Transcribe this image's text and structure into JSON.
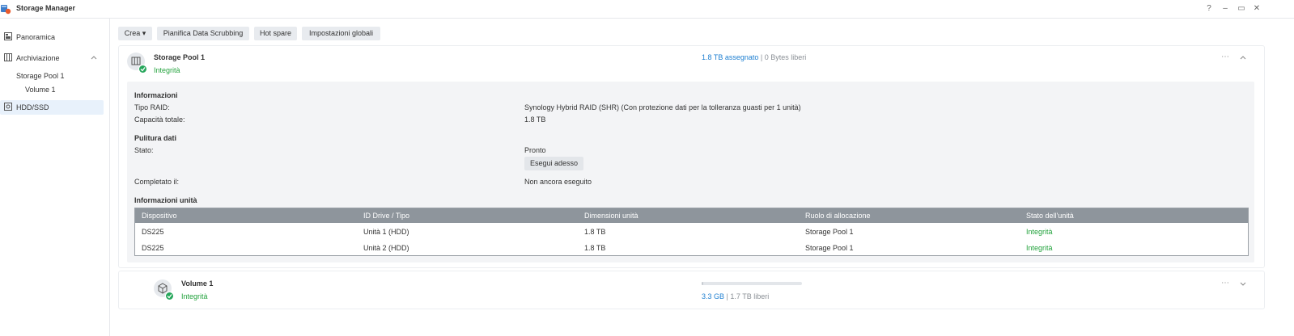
{
  "window": {
    "title": "Storage Manager",
    "help": "?",
    "minimize": "–",
    "restore": "▭",
    "close": "✕"
  },
  "sidebar": {
    "items": [
      {
        "label": "Panoramica",
        "icon": "overview-icon"
      },
      {
        "label": "Archiviazione",
        "icon": "storage-icon"
      },
      {
        "label": "HDD/SSD",
        "icon": "disk-icon"
      }
    ],
    "sub_items": [
      "Storage Pool 1",
      "Volume 1"
    ],
    "selected": "Volume 1"
  },
  "toolbar": {
    "create": "Crea",
    "scrubbing": "Pianifica Data Scrubbing",
    "hot_spare": "Hot spare",
    "global_settings": "Impostazioni globali"
  },
  "pool": {
    "title": "Storage Pool 1",
    "status": "Integrità",
    "assigned": "1.8 TB assegnato",
    "separator": "|",
    "free": "0 Bytes liberi",
    "info_header": "Informazioni",
    "raid_label": "Tipo RAID:",
    "raid_value": "Synology Hybrid RAID (SHR) (Con protezione dati per la tolleranza guasti per 1 unità)",
    "capacity_label": "Capacità totale:",
    "capacity_value": "1.8 TB",
    "scrub_header": "Pulitura dati",
    "state_label": "Stato:",
    "state_value": "Pronto",
    "run_now": "Esegui adesso",
    "completed_label": "Completato il:",
    "completed_value": "Non ancora eseguito",
    "units_header": "Informazioni unità",
    "table": {
      "columns": [
        "Dispositivo",
        "ID Drive / Tipo",
        "Dimensioni unità",
        "Ruolo di allocazione",
        "Stato dell'unità"
      ],
      "rows": [
        [
          "DS225",
          "Unità 1 (HDD)",
          "1.8 TB",
          "Storage Pool 1",
          "Integrità"
        ],
        [
          "DS225",
          "Unità 2 (HDD)",
          "1.8 TB",
          "Storage Pool 1",
          "Integrità"
        ]
      ]
    }
  },
  "volume": {
    "title": "Volume 1",
    "status": "Integrità",
    "used": "3.3 GB",
    "separator": "|",
    "free": "1.7 TB liberi",
    "usage_fraction": 0.002
  },
  "colors": {
    "accent": "#1e7fd1",
    "ok": "#24a33e",
    "header": "#8e959c"
  },
  "more_icon": "⋯"
}
